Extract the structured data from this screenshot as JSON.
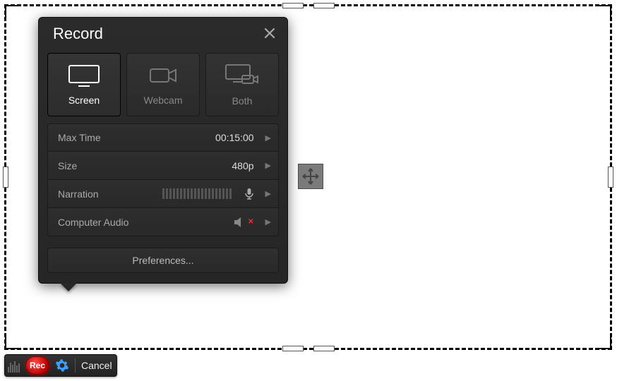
{
  "panel": {
    "title": "Record",
    "sources": {
      "screen": "Screen",
      "webcam": "Webcam",
      "both": "Both",
      "selected": "screen"
    },
    "options": {
      "maxTime": {
        "label": "Max Time",
        "value": "00:15:00"
      },
      "size": {
        "label": "Size",
        "value": "480p"
      },
      "narration": {
        "label": "Narration"
      },
      "computerAudio": {
        "label": "Computer Audio",
        "muted": true
      }
    },
    "preferences": "Preferences..."
  },
  "toolbar": {
    "rec": "Rec",
    "cancel": "Cancel"
  }
}
